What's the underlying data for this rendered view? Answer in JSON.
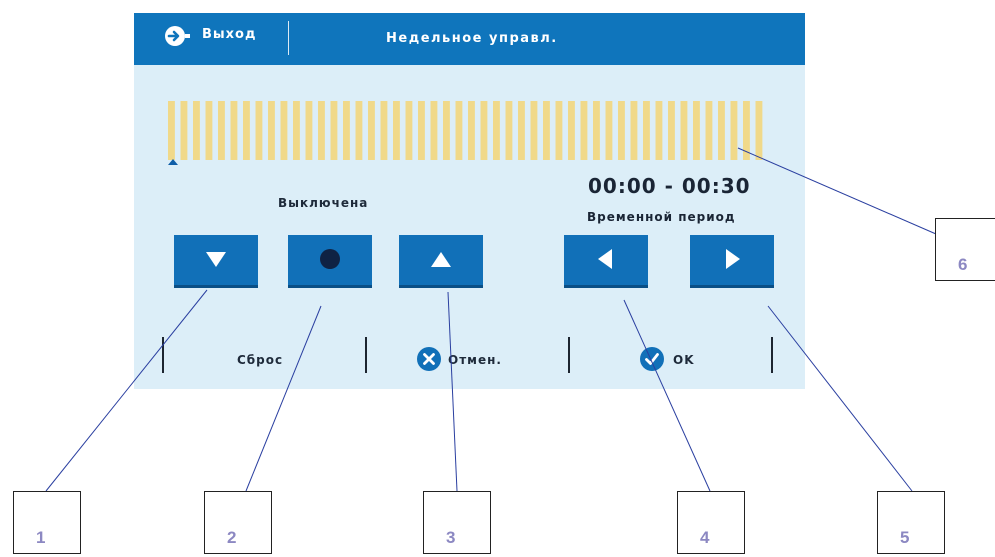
{
  "header": {
    "exit_label": "Выход",
    "title": "Недельное управл."
  },
  "schedule": {
    "mode_label": "Выключена",
    "period_time": "00:00 - 00:30",
    "period_label": "Временной период",
    "slot_count": 48,
    "slot_color": "#f0d98a",
    "marker_color": "#0f5ea8"
  },
  "buttons": {
    "down_icon": "triangle-down-icon",
    "dot_icon": "dot-icon",
    "up_icon": "triangle-up-icon",
    "left_icon": "triangle-left-icon",
    "right_icon": "triangle-right-icon"
  },
  "bottom": {
    "reset_label": "Сброс",
    "cancel_label": "Отмен.",
    "ok_label": "OK"
  },
  "callouts": [
    "1",
    "2",
    "3",
    "4",
    "5",
    "6"
  ],
  "colors": {
    "header_blue": "#0f75bc",
    "screen_bg": "#dceef8",
    "button_blue": "#1170b8",
    "line_blue": "#2a3fa0",
    "callout_text": "#8c88c2"
  }
}
